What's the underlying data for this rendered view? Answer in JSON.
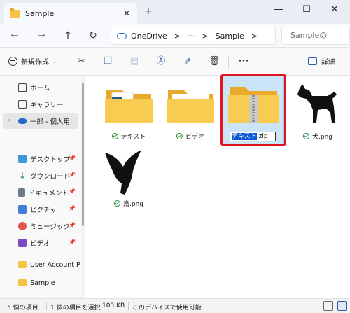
{
  "window": {
    "tab_title": "Sample",
    "tab_close": "✕",
    "new_tab": "+",
    "minimize": "—",
    "maximize": "☐",
    "close": "✕"
  },
  "address": {
    "back": "←",
    "forward": "→",
    "up": "↑",
    "refresh": "↻",
    "segments": [
      "OneDrive",
      ">",
      "···",
      ">",
      "Sample",
      ">"
    ],
    "search_placeholder": "Sampleの"
  },
  "commands": {
    "new_label": "新規作成",
    "new_chevron": "⌄",
    "more": "···",
    "details_label": "詳細"
  },
  "sidebar": {
    "items": [
      {
        "label": "ホーム",
        "icon": "home-icon"
      },
      {
        "label": "ギャラリー",
        "icon": "gallery-icon"
      },
      {
        "label": "一郎 - 個人用",
        "icon": "onedrive-icon"
      },
      {
        "label": "デスクトップ",
        "icon": "desktop-icon"
      },
      {
        "label": "ダウンロード",
        "icon": "download-icon"
      },
      {
        "label": "ドキュメント",
        "icon": "documents-icon"
      },
      {
        "label": "ピクチャ",
        "icon": "pictures-icon"
      },
      {
        "label": "ミュージック",
        "icon": "music-icon"
      },
      {
        "label": "ビデオ",
        "icon": "videos-icon"
      },
      {
        "label": "User Account Pic",
        "icon": "folder-icon"
      },
      {
        "label": "Sample",
        "icon": "folder-icon"
      }
    ]
  },
  "files": [
    {
      "name": "テキスト",
      "type": "folder"
    },
    {
      "name": "ビデオ",
      "type": "folder"
    },
    {
      "name": "テキスト.zip",
      "type": "zip"
    },
    {
      "name": "犬.png",
      "type": "image"
    },
    {
      "name": "鳥.png",
      "type": "image"
    }
  ],
  "rename": {
    "selected_part": "テキスト",
    "extension": ".zip"
  },
  "status": {
    "count": "5 個の項目",
    "selection": "1 個の項目を選択",
    "size": "103 KB",
    "availability": "このデバイスで使用可能"
  },
  "colors": {
    "accent": "#0a5ad4",
    "highlight_border": "#e0141e",
    "folder": "#f5c342"
  }
}
